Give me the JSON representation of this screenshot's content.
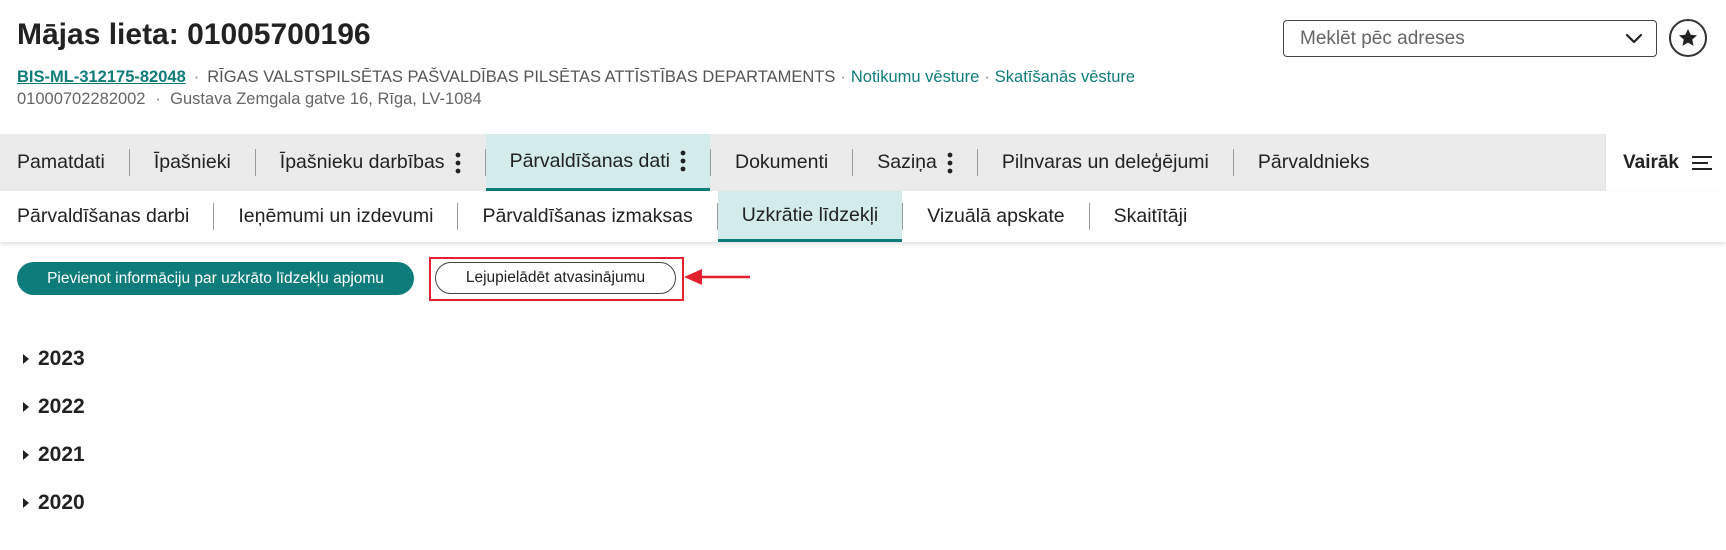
{
  "header": {
    "title": "Mājas lieta: 01005700196",
    "case_id": "BIS-ML-312175-82048",
    "separator": "·",
    "department": "RĪGAS VALSTSPILSĒTAS PAŠVALDĪBAS PILSĒTAS ATTĪSTĪBAS DEPARTAMENTS",
    "events_link": "Notikumu vēsture",
    "views_link": "Skatīšanās vēsture",
    "cadastre": "01000702282002",
    "address": "Gustava Zemgala gatve 16, Rīga, LV-1084"
  },
  "search": {
    "placeholder": "Meklēt pēc adreses"
  },
  "tabs": [
    {
      "label": "Pamatdati"
    },
    {
      "label": "Īpašnieki"
    },
    {
      "label": "Īpašnieku darbības"
    },
    {
      "label": "Pārvaldīšanas dati"
    },
    {
      "label": "Dokumenti"
    },
    {
      "label": "Saziņa"
    },
    {
      "label": "Pilnvaras un deleģējumi"
    },
    {
      "label": "Pārvaldnieks"
    }
  ],
  "more_label": "Vairāk",
  "subtabs": [
    {
      "label": "Pārvaldīšanas darbi"
    },
    {
      "label": "Ieņēmumi un izdevumi"
    },
    {
      "label": "Pārvaldīšanas izmaksas"
    },
    {
      "label": "Uzkrātie līdzekļi"
    },
    {
      "label": "Vizuālā apskate"
    },
    {
      "label": "Skaitītāji"
    }
  ],
  "actions": {
    "add_label": "Pievienot informāciju par uzkrāto līdzekļu apjomu",
    "download_label": "Lejupielādēt atvasinājumu"
  },
  "years": [
    "2023",
    "2022",
    "2021",
    "2020"
  ],
  "colors": {
    "accent": "#0e7c7b",
    "active_tab_bg": "#d3ebea",
    "annotation_red": "#e5202e"
  }
}
